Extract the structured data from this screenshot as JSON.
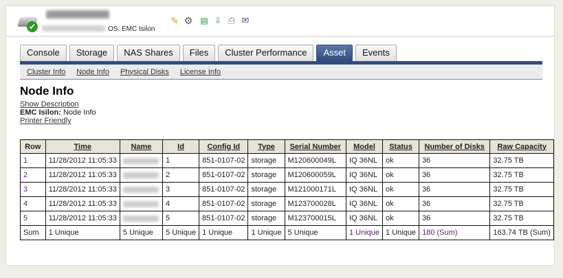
{
  "header": {
    "os_label": "OS: EMC Isilon",
    "icons": [
      "server-ok-icon",
      "pencil-icon",
      "gear-icon",
      "report-icon",
      "export-icon",
      "print-icon",
      "email-icon"
    ]
  },
  "tabs": [
    "Console",
    "Storage",
    "NAS Shares",
    "Files",
    "Cluster Performance",
    "Asset",
    "Events"
  ],
  "active_tab": "Asset",
  "subnav": [
    "Cluster Info",
    "Node Info",
    "Physical Disks",
    "License Info"
  ],
  "page": {
    "title": "Node Info",
    "show_description": "Show Description",
    "context_bold": "EMC Isilon:",
    "context_text": " Node Info",
    "printer_friendly": "Printer Friendly"
  },
  "table": {
    "headers": [
      "Row",
      "Time",
      "Name",
      "Id",
      "Config Id",
      "Type",
      "Serial Number",
      "Model",
      "Status",
      "Number of Disks",
      "Raw Capacity"
    ],
    "rows": [
      [
        "1",
        "11/28/2012 11:05:33",
        "",
        "1",
        "851-0107-02",
        "storage",
        "M120600049L",
        "IQ 36NL",
        "ok",
        "36",
        "32.75 TB"
      ],
      [
        "2",
        "11/28/2012 11:05:33",
        "",
        "2",
        "851-0107-02",
        "storage",
        "M120600059L",
        "IQ 36NL",
        "ok",
        "36",
        "32.75 TB"
      ],
      [
        "3",
        "11/28/2012 11:05:33",
        "",
        "3",
        "851-0107-02",
        "storage",
        "M121000171L",
        "IQ 36NL",
        "ok",
        "36",
        "32.75 TB"
      ],
      [
        "4",
        "11/28/2012 11:05:33",
        "",
        "4",
        "851-0107-02",
        "storage",
        "M123700028L",
        "IQ 36NL",
        "ok",
        "36",
        "32.75 TB"
      ],
      [
        "5",
        "11/28/2012 11:05:33",
        "",
        "5",
        "851-0107-02",
        "storage",
        "M123700015L",
        "IQ 36NL",
        "ok",
        "36",
        "32.75 TB"
      ]
    ],
    "sum": [
      "Sum",
      "1 Unique",
      "5 Unique",
      "5 Unique",
      "1 Unique",
      "1 Unique",
      "5 Unique",
      "1 Unique",
      "1 Unique",
      "180 (Sum)",
      "163.74 TB (Sum)"
    ]
  }
}
